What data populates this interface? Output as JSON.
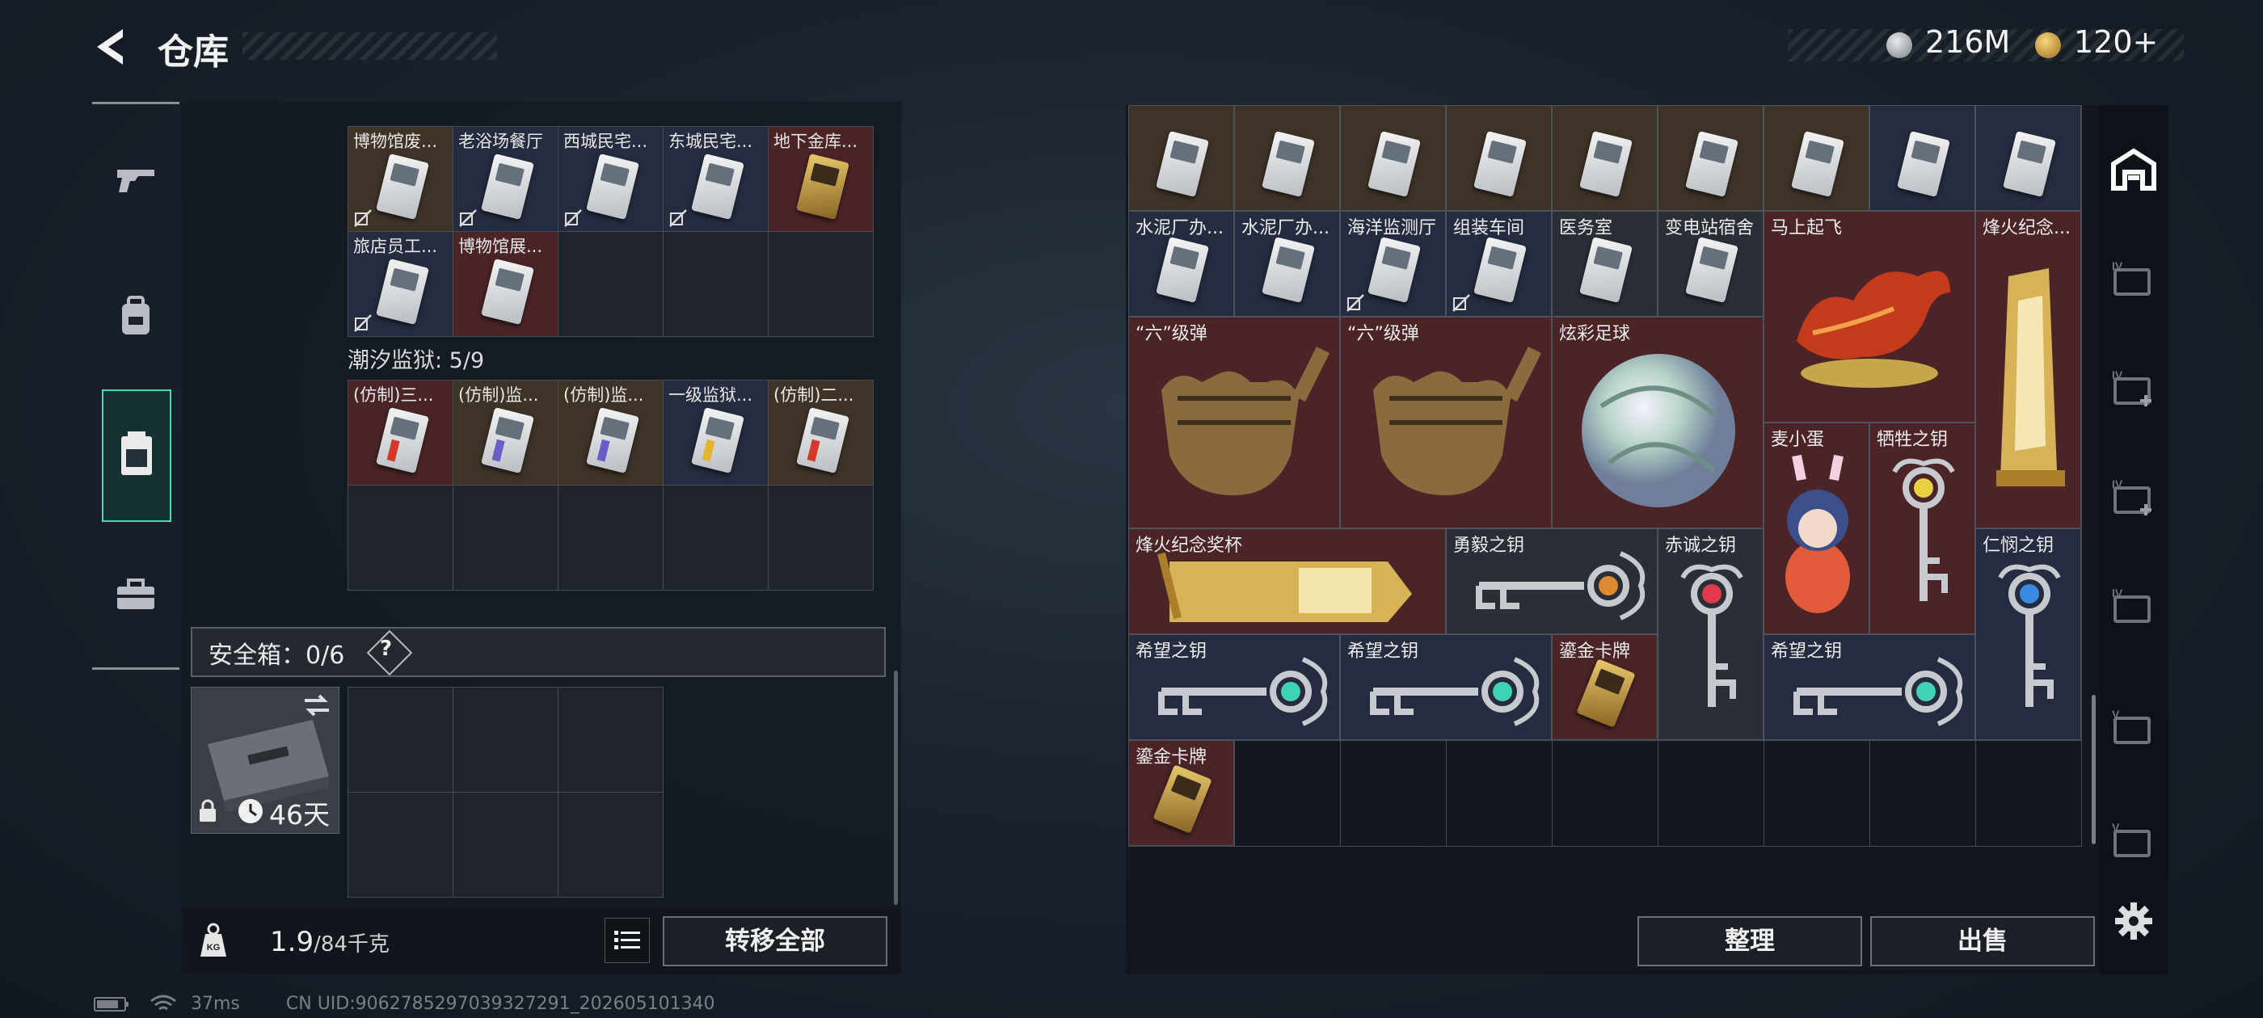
{
  "header": {
    "title": "仓库",
    "currency_silver": "216M",
    "currency_gold": "120+",
    "colors": {
      "silver": "#b8bcc2",
      "gold": "#d9a441",
      "accent": "#4fd6b4"
    }
  },
  "left_nav": {
    "items": [
      "gun-icon",
      "backpack-icon",
      "container-icon",
      "toolbox-icon"
    ],
    "active": "container-icon"
  },
  "sections": [
    {
      "label": "",
      "items": [
        {
          "name": "博物馆废...",
          "bg": "brown",
          "card": "card",
          "locked": true
        },
        {
          "name": "老浴场餐厅",
          "bg": "blue",
          "card": "card",
          "locked": true
        },
        {
          "name": "西城民宅...",
          "bg": "blue",
          "card": "card",
          "locked": true
        },
        {
          "name": "东城民宅...",
          "bg": "blue",
          "card": "card",
          "locked": true
        },
        {
          "name": "地下金库...",
          "bg": "red",
          "card": "goldcard",
          "locked": false
        },
        {
          "name": "旅店员工...",
          "bg": "blue",
          "card": "card",
          "locked": true
        },
        {
          "name": "博物馆展...",
          "bg": "red",
          "card": "card",
          "locked": false
        },
        {
          "name": "",
          "bg": "empty"
        },
        {
          "name": "",
          "bg": "empty"
        },
        {
          "name": "",
          "bg": "empty"
        }
      ]
    },
    {
      "label": "潮汐监狱: 5/9",
      "items": [
        {
          "name": "(仿制)三...",
          "bg": "red",
          "card": "red-stripe"
        },
        {
          "name": "(仿制)监...",
          "bg": "brown",
          "card": "purple-stripe"
        },
        {
          "name": "(仿制)监...",
          "bg": "brown",
          "card": "purple-stripe"
        },
        {
          "name": "一级监狱...",
          "bg": "blue",
          "card": "yellow-stripe"
        },
        {
          "name": "(仿制)二...",
          "bg": "brown",
          "card": "red-stripe"
        },
        {
          "name": "",
          "bg": "empty"
        },
        {
          "name": "",
          "bg": "empty"
        },
        {
          "name": "",
          "bg": "empty"
        },
        {
          "name": "",
          "bg": "empty"
        },
        {
          "name": "",
          "bg": "empty"
        }
      ]
    }
  ],
  "safe_box": {
    "label": "安全箱：0/6",
    "help": "?",
    "days": "46天"
  },
  "weight": {
    "current": "1.9",
    "max": "/84千克"
  },
  "buttons": {
    "transfer_all": "转移全部",
    "sort": "整理",
    "sell": "出售"
  },
  "status": {
    "ping": "37ms",
    "uid": "CN UID:9062785297039327291_202605101340"
  },
  "stash_items": [
    {
      "name": "",
      "col": 0,
      "row": 0,
      "w": 1,
      "h": 1,
      "bg": "brown",
      "kind": "card"
    },
    {
      "name": "",
      "col": 1,
      "row": 0,
      "w": 1,
      "h": 1,
      "bg": "brown",
      "kind": "card"
    },
    {
      "name": "",
      "col": 2,
      "row": 0,
      "w": 1,
      "h": 1,
      "bg": "brown",
      "kind": "card"
    },
    {
      "name": "",
      "col": 3,
      "row": 0,
      "w": 1,
      "h": 1,
      "bg": "brown",
      "kind": "card"
    },
    {
      "name": "",
      "col": 4,
      "row": 0,
      "w": 1,
      "h": 1,
      "bg": "brown",
      "kind": "card"
    },
    {
      "name": "",
      "col": 5,
      "row": 0,
      "w": 1,
      "h": 1,
      "bg": "brown",
      "kind": "card"
    },
    {
      "name": "",
      "col": 6,
      "row": 0,
      "w": 1,
      "h": 1,
      "bg": "brown",
      "kind": "card"
    },
    {
      "name": "",
      "col": 7,
      "row": 0,
      "w": 1,
      "h": 1,
      "bg": "blue",
      "kind": "card"
    },
    {
      "name": "",
      "col": 8,
      "row": 0,
      "w": 1,
      "h": 1,
      "bg": "blue",
      "kind": "card"
    },
    {
      "name": "水泥厂办...",
      "col": 0,
      "row": 1,
      "w": 1,
      "h": 1,
      "bg": "blue",
      "kind": "card"
    },
    {
      "name": "水泥厂办...",
      "col": 1,
      "row": 1,
      "w": 1,
      "h": 1,
      "bg": "blue",
      "kind": "card"
    },
    {
      "name": "海洋监测厅",
      "col": 2,
      "row": 1,
      "w": 1,
      "h": 1,
      "bg": "blue",
      "kind": "card",
      "locked": true
    },
    {
      "name": "组装车间",
      "col": 3,
      "row": 1,
      "w": 1,
      "h": 1,
      "bg": "blue",
      "kind": "card",
      "locked": true
    },
    {
      "name": "医务室",
      "col": 4,
      "row": 1,
      "w": 1,
      "h": 1,
      "bg": "dark",
      "kind": "card"
    },
    {
      "name": "变电站宿舍",
      "col": 5,
      "row": 1,
      "w": 1,
      "h": 1,
      "bg": "dark",
      "kind": "card"
    },
    {
      "name": "马上起飞",
      "col": 6,
      "row": 1,
      "w": 2,
      "h": 2,
      "bg": "red",
      "kind": "horse"
    },
    {
      "name": "烽火纪念...",
      "col": 8,
      "row": 1,
      "w": 1,
      "h": 3,
      "bg": "red",
      "kind": "trophy"
    },
    {
      "name": "“六”级弹",
      "col": 0,
      "row": 2,
      "w": 2,
      "h": 2,
      "bg": "red",
      "kind": "gauntlet"
    },
    {
      "name": "“六”级弹",
      "col": 2,
      "row": 2,
      "w": 2,
      "h": 2,
      "bg": "red",
      "kind": "gauntlet"
    },
    {
      "name": "炫彩足球",
      "col": 4,
      "row": 2,
      "w": 2,
      "h": 2,
      "bg": "red",
      "kind": "ball"
    },
    {
      "name": "麦小蛋",
      "col": 6,
      "row": 3,
      "w": 1,
      "h": 2,
      "bg": "red",
      "kind": "doll"
    },
    {
      "name": "牺牲之钥",
      "col": 7,
      "row": 3,
      "w": 1,
      "h": 2,
      "bg": "red",
      "kind": "vkey-gold"
    },
    {
      "name": "烽火纪念奖杯",
      "col": 0,
      "row": 4,
      "w": 3,
      "h": 1,
      "bg": "red",
      "kind": "bar"
    },
    {
      "name": "勇毅之钥",
      "col": 3,
      "row": 4,
      "w": 2,
      "h": 1,
      "bg": "dark",
      "kind": "hkey-orange"
    },
    {
      "name": "赤诚之钥",
      "col": 5,
      "row": 4,
      "w": 1,
      "h": 2,
      "bg": "dark",
      "kind": "vkey-red"
    },
    {
      "name": "仁悯之钥",
      "col": 8,
      "row": 4,
      "w": 1,
      "h": 2,
      "bg": "blue",
      "kind": "vkey-blue"
    },
    {
      "name": "希望之钥",
      "col": 0,
      "row": 5,
      "w": 2,
      "h": 1,
      "bg": "blue",
      "kind": "hkey-teal"
    },
    {
      "name": "希望之钥",
      "col": 2,
      "row": 5,
      "w": 2,
      "h": 1,
      "bg": "blue",
      "kind": "hkey-teal"
    },
    {
      "name": "鎏金卡牌",
      "col": 4,
      "row": 5,
      "w": 1,
      "h": 1,
      "bg": "red",
      "kind": "goldcard"
    },
    {
      "name": "希望之钥",
      "col": 6,
      "row": 5,
      "w": 2,
      "h": 1,
      "bg": "blue",
      "kind": "hkey-teal"
    },
    {
      "name": "鎏金卡牌",
      "col": 0,
      "row": 6,
      "w": 1,
      "h": 1,
      "bg": "red",
      "kind": "goldcard"
    }
  ],
  "right_nav": {
    "items": [
      "stash-icon",
      "tab-iv-1-icon",
      "tab-iv-add-1-icon",
      "tab-iv-add-2-icon",
      "tab-iv-key-icon",
      "tab-v-1-icon",
      "tab-v-2-icon"
    ],
    "settings": "gear-icon"
  }
}
